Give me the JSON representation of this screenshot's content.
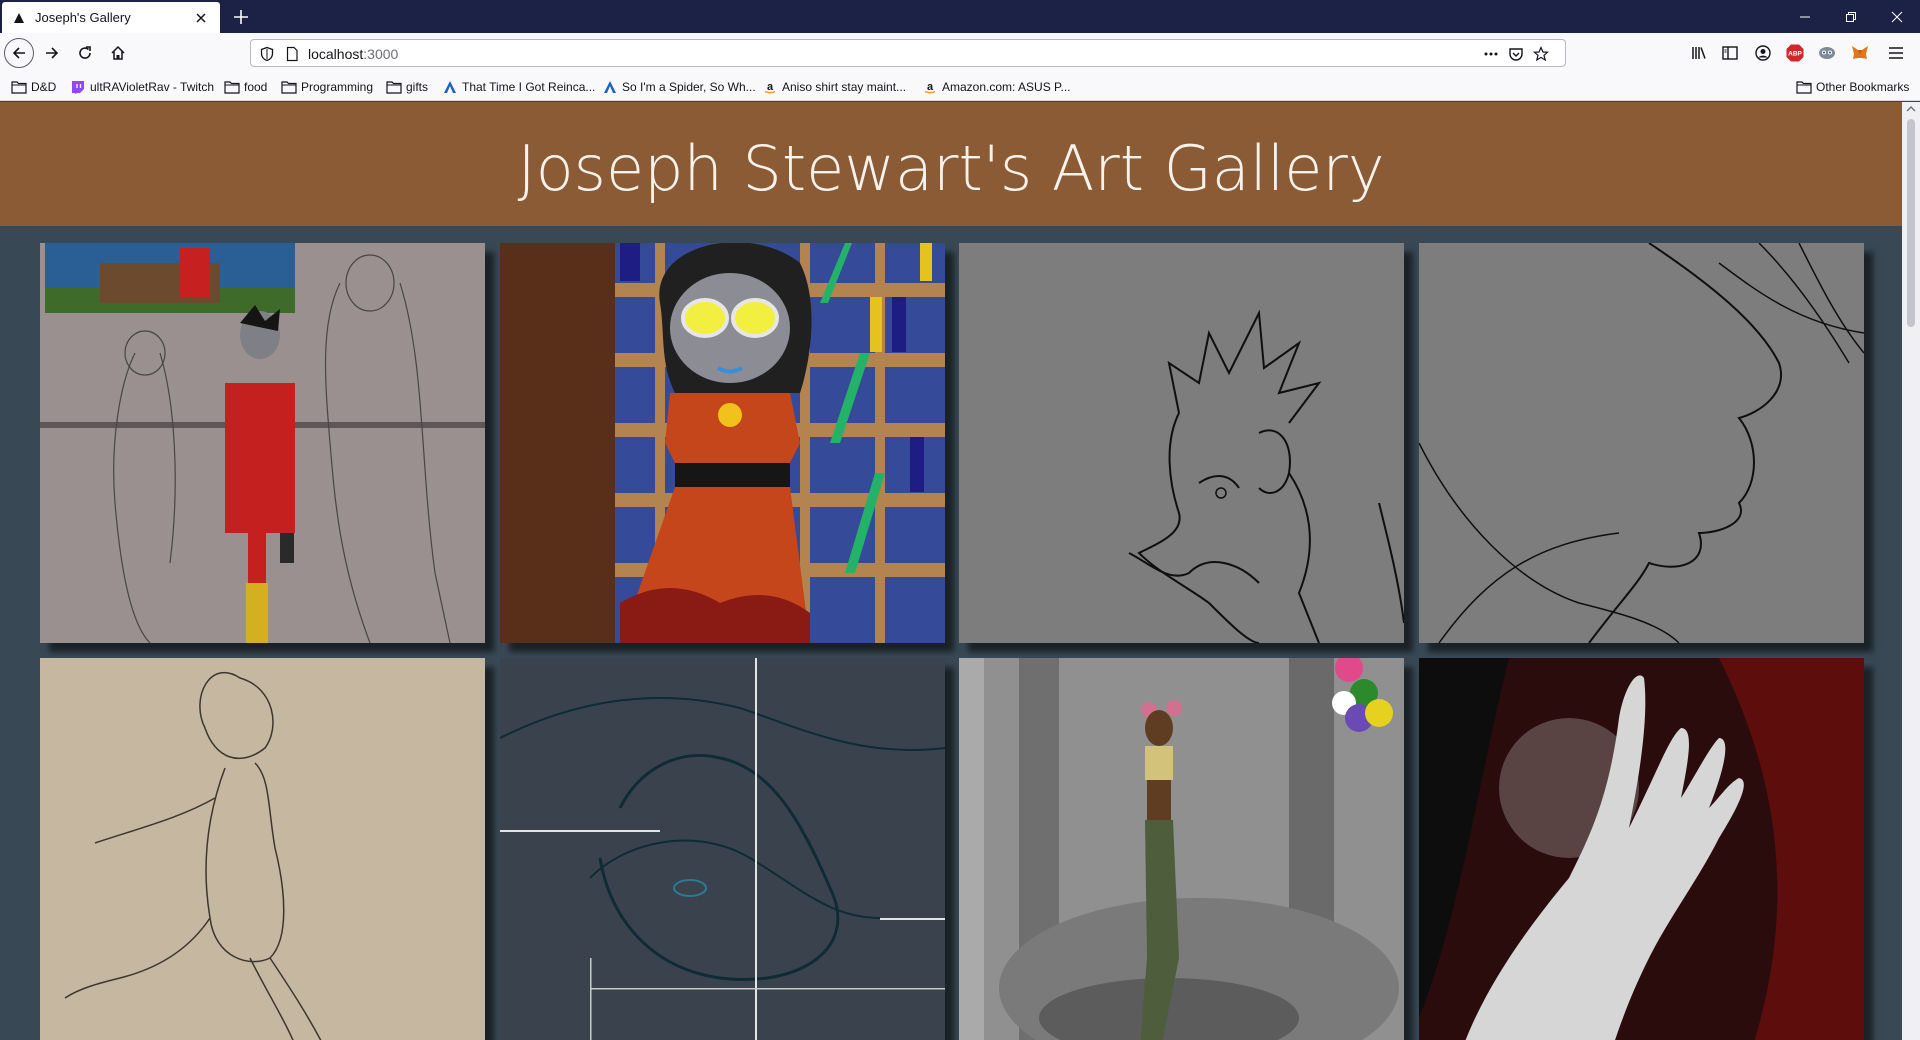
{
  "browser": {
    "tab_title": "Joseph's Gallery",
    "url_host": "localhost",
    "url_port": ":3000",
    "bookmarks": [
      {
        "label": "D&D",
        "icon": "folder-icon"
      },
      {
        "label": "ultRAVioletRav - Twitch",
        "icon": "twitch-icon"
      },
      {
        "label": "food",
        "icon": "folder-icon"
      },
      {
        "label": "Programming",
        "icon": "folder-icon"
      },
      {
        "label": "gifts",
        "icon": "folder-icon"
      },
      {
        "label": "That Time I Got Reinca...",
        "icon": "site-a-icon"
      },
      {
        "label": "So I'm a Spider, So Wh...",
        "icon": "site-a-icon"
      },
      {
        "label": "Aniso shirt stay maint...",
        "icon": "amazon-icon"
      },
      {
        "label": "Amazon.com: ASUS P...",
        "icon": "amazon-icon"
      }
    ],
    "other_bookmarks": "Other Bookmarks",
    "colors": {
      "tabbar": "#1c2246",
      "toolbar": "#f9f9fb"
    }
  },
  "page": {
    "title": "Joseph Stewart's Art Gallery",
    "colors": {
      "header": "#8b5b35",
      "background": "#384955",
      "title_text": "#f8f2ec"
    },
    "gallery": [
      {
        "name": "artwork-1",
        "description": "sketch of three figures with character in red overalls, game screenshot inset"
      },
      {
        "name": "artwork-2",
        "description": "character in orange dress with glasses in front of bookshelf"
      },
      {
        "name": "artwork-3",
        "description": "line sketch of spiky-haired face"
      },
      {
        "name": "artwork-4",
        "description": "line sketch close-up profile"
      },
      {
        "name": "artwork-5",
        "description": "pencil figure sketch on tan"
      },
      {
        "name": "artwork-6",
        "description": "dark teal abstract eye sketch with guides"
      },
      {
        "name": "artwork-7",
        "description": "gray forest painting with figure and flower crown"
      },
      {
        "name": "artwork-8",
        "description": "glowing hand on red dark background"
      }
    ]
  }
}
